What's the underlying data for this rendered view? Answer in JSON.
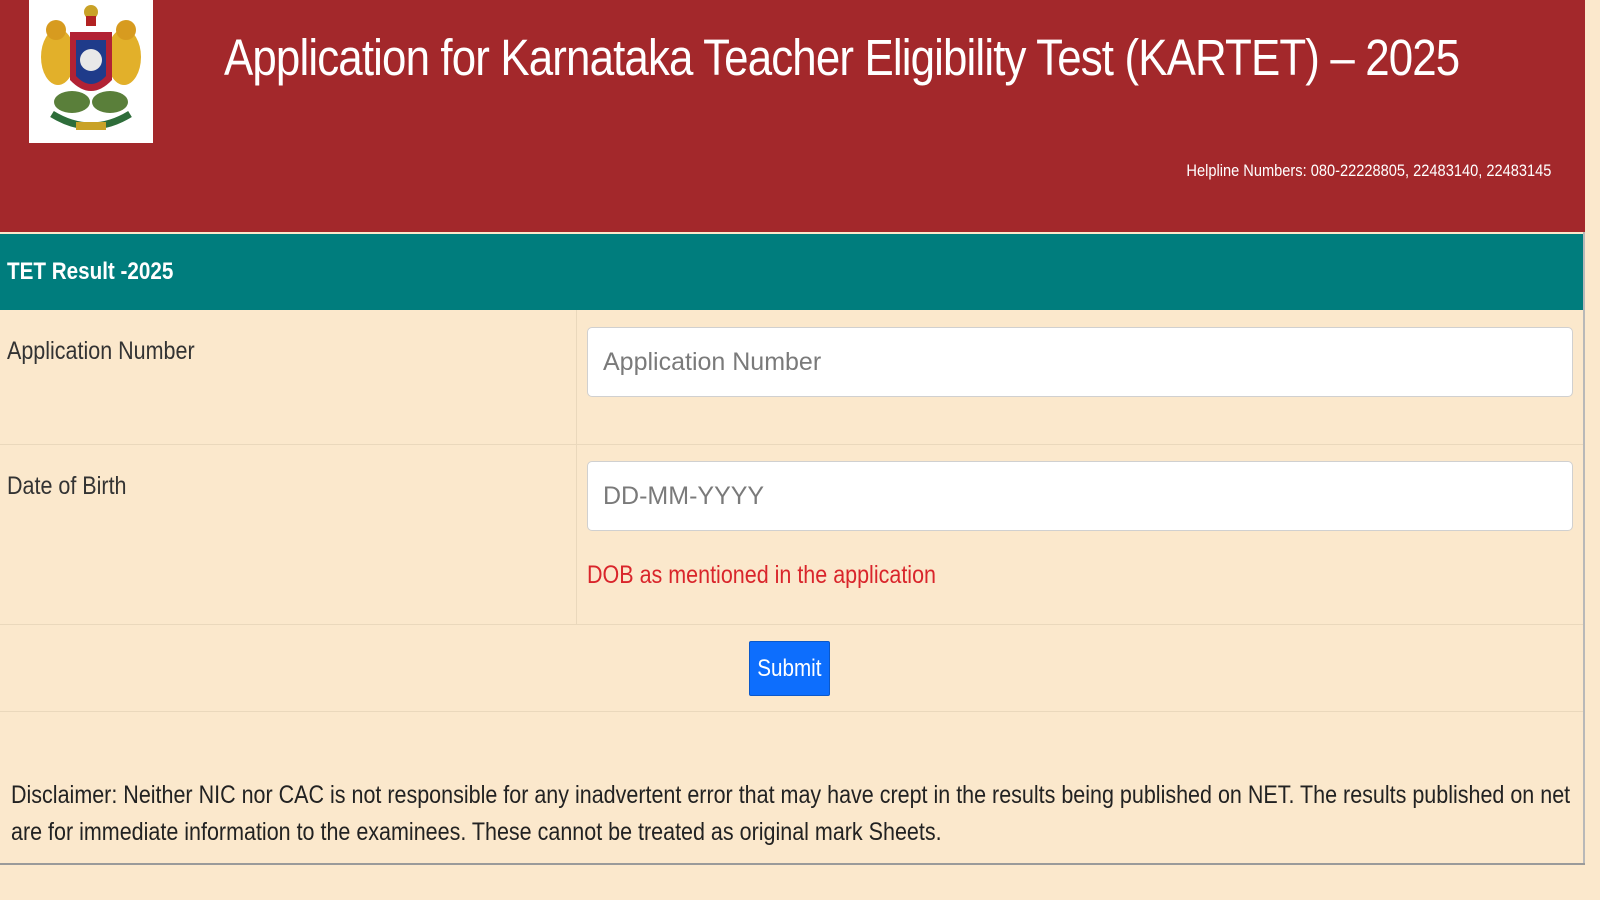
{
  "header": {
    "title": "Application for Karnataka Teacher Eligibility Test (KARTET) – 2025",
    "helpline": "Helpline Numbers: 080-22228805, 22483140, 22483145",
    "emblem_icon": "karnataka-emblem-icon"
  },
  "section": {
    "title": "TET Result -2025"
  },
  "form": {
    "application_number": {
      "label": "Application Number",
      "placeholder": "Application Number",
      "value": ""
    },
    "dob": {
      "label": "Date of Birth",
      "placeholder": "DD-MM-YYYY",
      "value": "",
      "hint": "DOB as mentioned in the application"
    },
    "submit_label": "Submit"
  },
  "disclaimer": "Disclaimer: Neither NIC nor CAC is not responsible for any inadvertent error that may have crept in the results being published on NET. The results published on net are for immediate information to the examinees. These cannot be treated as original mark Sheets.",
  "colors": {
    "header_bg": "#a3282b",
    "section_bg": "#007d7d",
    "page_bg": "#fbe8cc",
    "button_bg": "#0d6efd",
    "hint_text": "#d9252b"
  }
}
